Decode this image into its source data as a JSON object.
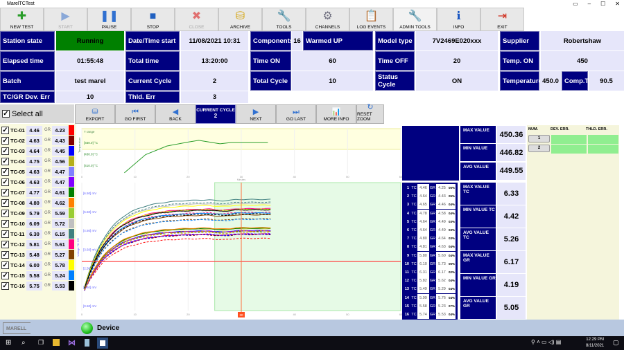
{
  "window": {
    "title": "MarelTCTest",
    "controls": [
      "▭",
      "–",
      "☐",
      "✕"
    ]
  },
  "toolbar": [
    {
      "label": "NEW TEST",
      "icon": "new-test-icon",
      "glyph": "✚",
      "color": "#2a9d2a",
      "enabled": true
    },
    {
      "label": "START",
      "icon": "play-icon",
      "glyph": "▶",
      "color": "#8aa8d8",
      "enabled": false
    },
    {
      "label": "PAUSE",
      "icon": "pause-icon",
      "glyph": "❚❚",
      "color": "#3070d0",
      "enabled": true
    },
    {
      "label": "STOP",
      "icon": "stop-icon",
      "glyph": "■",
      "color": "#2060c0",
      "enabled": true
    },
    {
      "label": "CLOSE",
      "icon": "close-icon",
      "glyph": "✖",
      "color": "#e07070",
      "enabled": false
    },
    {
      "label": "ARCHIVE",
      "icon": "archive-icon",
      "glyph": "⛁",
      "color": "#d4a000",
      "enabled": true
    },
    {
      "label": "TOOLS",
      "icon": "wrench-icon",
      "glyph": "🔧",
      "color": "#e0a000",
      "enabled": true
    },
    {
      "label": "CHANNELS",
      "icon": "gear-icon",
      "glyph": "⚙",
      "color": "#707080",
      "enabled": true
    },
    {
      "label": "LOG EVENTS",
      "icon": "clipboard-icon",
      "glyph": "📋",
      "color": "#3060c0",
      "enabled": true
    },
    {
      "label": "ADMIN TOOLS",
      "icon": "admin-wrench-icon",
      "glyph": "🔧",
      "color": "#e0a000",
      "enabled": true,
      "active": true
    },
    {
      "label": "INFO",
      "icon": "info-icon",
      "glyph": "ℹ",
      "color": "#1050c0",
      "enabled": true
    },
    {
      "label": "EXIT",
      "icon": "exit-icon",
      "glyph": "⇥",
      "color": "#d03020",
      "enabled": true
    }
  ],
  "info": {
    "station_state": {
      "label": "Station state",
      "value": "Running"
    },
    "date_start": {
      "label": "Date/Time start",
      "value": "11/08/2021 10:31"
    },
    "components": {
      "label": "Components",
      "value": "16",
      "status": "Warmed UP"
    },
    "model_type": {
      "label": "Model type",
      "value": "7V2469E020xxx"
    },
    "supplier": {
      "label": "Supplier",
      "value": "Robertshaw"
    },
    "elapsed": {
      "label": "Elapsed time",
      "value": "01:55:48"
    },
    "total_time": {
      "label": "Total time",
      "value": "13:20:00"
    },
    "time_on": {
      "label": "Time ON",
      "value": "60"
    },
    "time_off": {
      "label": "Time OFF",
      "value": "20"
    },
    "temp_on": {
      "label": "Temp. ON",
      "value": "450"
    },
    "batch": {
      "label": "Batch",
      "value": "test marel"
    },
    "current_cycle": {
      "label": "Current Cycle",
      "value": "2"
    },
    "total_cycle": {
      "label": "Total Cycle",
      "value": "10"
    },
    "status_cycle": {
      "label": "Status Cycle",
      "value": "ON"
    },
    "temperature": {
      "label": "Temperature",
      "value": "450.0"
    },
    "comp_t": {
      "label": "Comp.T.",
      "value": "90.5"
    },
    "dev_err": {
      "label": "TC/GR Dev. Err",
      "value": "10"
    },
    "thld_err": {
      "label": "Thld. Err",
      "value": "3"
    }
  },
  "select_all": {
    "label": "Select all",
    "checked": true
  },
  "channels": [
    {
      "name": "TC-01",
      "tc": "4.46",
      "gr_label": "GR",
      "gr": "4.23",
      "color": "#ff0000"
    },
    {
      "name": "TC-02",
      "tc": "4.63",
      "gr_label": "GR",
      "gr": "4.43",
      "color": "#800000"
    },
    {
      "name": "TC-03",
      "tc": "4.64",
      "gr_label": "GR",
      "gr": "4.45",
      "color": "#0000ff"
    },
    {
      "name": "TC-04",
      "tc": "4.75",
      "gr_label": "GR",
      "gr": "4.56",
      "color": "#b5b01a"
    },
    {
      "name": "TC-05",
      "tc": "4.63",
      "gr_label": "GR",
      "gr": "4.47",
      "color": "#8080ff"
    },
    {
      "name": "TC-06",
      "tc": "4.63",
      "gr_label": "GR",
      "gr": "4.47",
      "color": "#8000ff"
    },
    {
      "name": "TC-07",
      "tc": "4.77",
      "gr_label": "GR",
      "gr": "4.61",
      "color": "#008000"
    },
    {
      "name": "TC-08",
      "tc": "4.80",
      "gr_label": "GR",
      "gr": "4.62",
      "color": "#ff8000"
    },
    {
      "name": "TC-09",
      "tc": "5.79",
      "gr_label": "GR",
      "gr": "5.59",
      "color": "#9acd32"
    },
    {
      "name": "TC-10",
      "tc": "6.09",
      "gr_label": "GR",
      "gr": "5.72",
      "color": "#c0c0c0"
    },
    {
      "name": "TC-11",
      "tc": "6.30",
      "gr_label": "GR",
      "gr": "6.15",
      "color": "#408080"
    },
    {
      "name": "TC-12",
      "tc": "5.81",
      "gr_label": "GR",
      "gr": "5.61",
      "color": "#ff0080"
    },
    {
      "name": "TC-13",
      "tc": "5.48",
      "gr_label": "GR",
      "gr": "5.27",
      "color": "#804000"
    },
    {
      "name": "TC-14",
      "tc": "6.00",
      "gr_label": "GR",
      "gr": "5.78",
      "color": "#ffff00"
    },
    {
      "name": "TC-15",
      "tc": "5.58",
      "gr_label": "GR",
      "gr": "5.24",
      "color": "#0080ff"
    },
    {
      "name": "TC-16",
      "tc": "5.75",
      "gr_label": "GR",
      "gr": "5.53",
      "color": "#000000"
    }
  ],
  "nav": [
    {
      "label": "EXPORT",
      "icon": "export-icon",
      "glyph": "⛁"
    },
    {
      "label": "GO FIRST",
      "icon": "go-first-icon",
      "glyph": "⏮"
    },
    {
      "label": "BACK",
      "icon": "back-icon",
      "glyph": "◀"
    },
    {
      "label": "NEXT",
      "icon": "next-icon",
      "glyph": "▶"
    },
    {
      "label": "GO LAST",
      "icon": "go-last-icon",
      "glyph": "⏭"
    },
    {
      "label": "MORE INFO",
      "icon": "chart-icon",
      "glyph": "📊"
    },
    {
      "label": "RESET ZOOM",
      "icon": "reset-zoom-icon",
      "glyph": "↻"
    }
  ],
  "current_cycle_box": {
    "label": "CURRENT CYCLE",
    "value": "2"
  },
  "chart_data": [
    {
      "type": "line",
      "ylabel": "Temperature",
      "legend": "T range",
      "xlabel": "Minutes",
      "xlim": [
        0,
        60
      ],
      "xticks": [
        "0",
        "10",
        "20",
        "30",
        "40",
        "50",
        "60"
      ],
      "yticks": [
        "[450.0] °C",
        "[430.0] °C",
        "[410.0] °C"
      ],
      "series": [
        {
          "color": "#2a9d2a",
          "x": [
            8,
            12,
            16,
            20,
            22,
            24,
            26,
            28,
            35
          ],
          "y": [
            398,
            430,
            445,
            452,
            455,
            452,
            449,
            451,
            451
          ]
        }
      ],
      "band_color": "#ffffe0"
    },
    {
      "type": "line",
      "ylabel": "Voltage TH GR",
      "xlabel": "Minutes",
      "xlim": [
        0,
        60
      ],
      "ylim": [
        0.5,
        6.5
      ],
      "xticks": [
        "0",
        "10",
        "20",
        "30",
        "40",
        "50",
        "60"
      ],
      "yticks": [
        "[6.50] mV",
        "[5.50] mV",
        "[4.50] mV",
        "[3.50] mV",
        "[2.50] mV",
        "[1.50] mV",
        "[0.50] mV"
      ],
      "threshold": 3.0,
      "threshold_color": "#ff4040",
      "cursor_x": 30,
      "cursor_label": "30",
      "highlight_range": [
        25,
        60
      ],
      "highlight_color": "#e6fae6",
      "end_x": 35.5,
      "note": "one solid (TC) and one dashed (GR) curve per channel, plateauing at the channel values"
    }
  ],
  "temp_stats": [
    {
      "label": "MAX VALUE",
      "value": "450.36"
    },
    {
      "label": "MIN VALUE",
      "value": "446.82"
    },
    {
      "label": "AVG VALUE",
      "value": "449.55"
    }
  ],
  "tc_stats": [
    {
      "label": "MAX VALUE TC",
      "value": "6.33"
    },
    {
      "label": "MIN VALUE TC",
      "value": "4.42"
    },
    {
      "label": "AVG VALUE TC",
      "value": "5.26"
    },
    {
      "label": "MAX VALUE GR",
      "value": "6.17"
    },
    {
      "label": "MIN VALUE GR",
      "value": "4.19"
    },
    {
      "label": "AVG VALUE GR",
      "value": "5.05"
    }
  ],
  "tc_table": [
    {
      "n": "1",
      "tc": "4.46",
      "gr": "4.25",
      "pct": "05%"
    },
    {
      "n": "2",
      "tc": "4.64",
      "gr": "4.43",
      "pct": "05%"
    },
    {
      "n": "3",
      "tc": "4.65",
      "gr": "4.46",
      "pct": "04%"
    },
    {
      "n": "4",
      "tc": "4.78",
      "gr": "4.58",
      "pct": "04%"
    },
    {
      "n": "5",
      "tc": "4.64",
      "gr": "4.49",
      "pct": "03%"
    },
    {
      "n": "6",
      "tc": "4.64",
      "gr": "4.49",
      "pct": "03%"
    },
    {
      "n": "7",
      "tc": "4.80",
      "gr": "4.64",
      "pct": "03%"
    },
    {
      "n": "8",
      "tc": "4.81",
      "gr": "4.63",
      "pct": "04%"
    },
    {
      "n": "9",
      "tc": "5.80",
      "gr": "5.60",
      "pct": "04%"
    },
    {
      "n": "10",
      "tc": "6.10",
      "gr": "5.73",
      "pct": "06%"
    },
    {
      "n": "11",
      "tc": "6.31",
      "gr": "6.17",
      "pct": "02%"
    },
    {
      "n": "12",
      "tc": "5.82",
      "gr": "5.62",
      "pct": "04%"
    },
    {
      "n": "13",
      "tc": "5.49",
      "gr": "5.29",
      "pct": "04%"
    },
    {
      "n": "14",
      "tc": "5.99",
      "gr": "5.76",
      "pct": "04%"
    },
    {
      "n": "15",
      "tc": "5.58",
      "gr": "5.23",
      "pct": "07%"
    },
    {
      "n": "16",
      "tc": "5.74",
      "gr": "5.53",
      "pct": "04%"
    }
  ],
  "tc_table_labels": {
    "tc": "TC",
    "gr": "GR"
  },
  "err_table": {
    "headers": [
      "NUM.",
      "DEV. ERR.",
      "THLD. ERR."
    ],
    "rows": [
      "1",
      "2"
    ]
  },
  "status": {
    "logo": "MARELL",
    "device_label": "Device",
    "device_color": "#20c020"
  },
  "taskbar": {
    "time": "12:29 PM",
    "date": "8/11/2021"
  }
}
